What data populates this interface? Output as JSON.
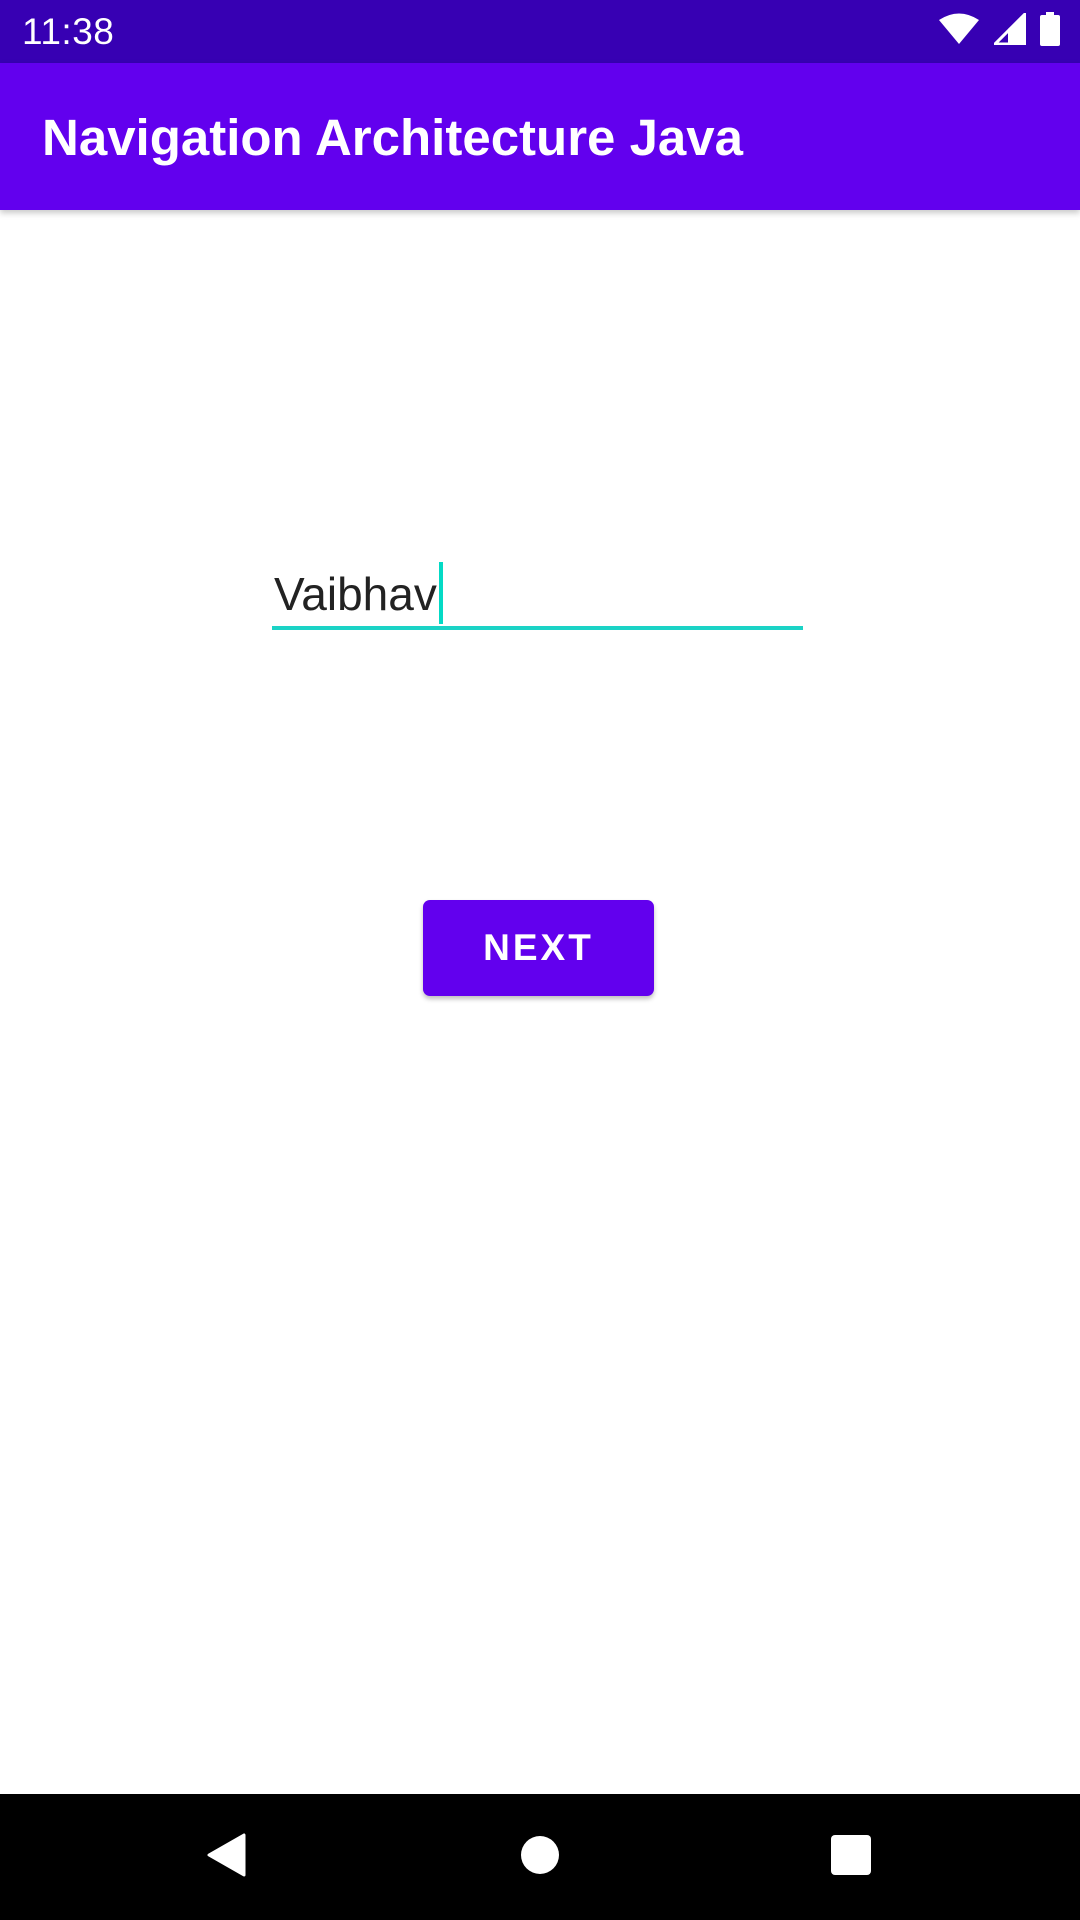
{
  "status_bar": {
    "time": "11:38",
    "icons": [
      "wifi-icon",
      "cell-signal-icon",
      "battery-icon"
    ],
    "background": "#3700B3"
  },
  "app_bar": {
    "title": "Navigation Architecture Java",
    "background": "#6200EE"
  },
  "form": {
    "name_input": {
      "value": "Vaibhav",
      "focused": true,
      "accent": "#03DAC5"
    },
    "next_button": {
      "label": "NEXT",
      "background": "#6200EE"
    }
  },
  "nav_bar": {
    "buttons": [
      "back-icon",
      "home-icon",
      "recents-icon"
    ]
  }
}
